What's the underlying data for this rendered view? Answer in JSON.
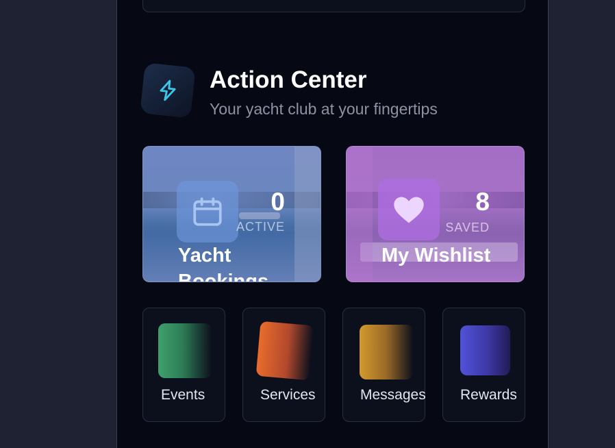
{
  "header": {
    "icon": "lightning-bolt-icon",
    "title": "Action Center",
    "subtitle": "Your yacht club at your fingertips"
  },
  "cards": [
    {
      "icon": "calendar-icon",
      "count": "0",
      "status": "ACTIVE",
      "title": "Yacht Bookings",
      "accent": "#6f86c2"
    },
    {
      "icon": "heart-icon",
      "count": "8",
      "status": "SAVED",
      "title": "My Wishlist",
      "accent": "#a56ec6"
    }
  ],
  "quick_actions": [
    {
      "label": "Events",
      "color": "#3f9f6c"
    },
    {
      "label": "Services",
      "color": "#e96c2c"
    },
    {
      "label": "Messages",
      "color": "#d29a2c"
    },
    {
      "label": "Rewards",
      "color": "#5152d9"
    }
  ]
}
